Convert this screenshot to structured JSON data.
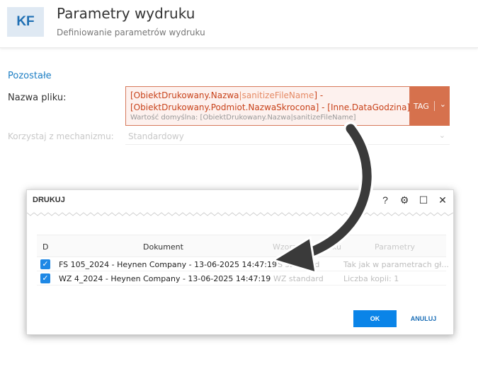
{
  "header": {
    "logo": "KF",
    "title": "Parametry wydruku",
    "subtitle": "Definiowanie parametrów wydruku"
  },
  "section": {
    "title": "Pozostałe"
  },
  "filename_field": {
    "label": "Nazwa pliku:",
    "line1_a": "[ObiektDrukowany.Nazwa",
    "line1_b": "|sanitizeFileName",
    "line1_c": "] -",
    "line2": "[ObiektDrukowany.Podmiot.NazwaSkrocona] - [Inne.DataGodzina]",
    "default_hint": "Wartość domyślna: [ObiektDrukowany.Nazwa|sanitizeFileName]",
    "tag_button": "TAG",
    "tag_chevron": "⌄"
  },
  "mechanism_field": {
    "label": "Korzystaj z mechanizmu:",
    "value": "Standardowy",
    "chevron": "⌄"
  },
  "dialog": {
    "title": "DRUKUJ",
    "icons": [
      "help-icon",
      "gear-icon",
      "maximize-icon",
      "close-icon"
    ],
    "icon_glyphs": [
      "?",
      "⚙",
      "☐",
      "✕"
    ],
    "columns": [
      "D",
      "Dokument",
      "Wzorzec wydruku",
      "Parametry"
    ],
    "rows": [
      {
        "checked": true,
        "document": "FS 105_2024 - Heynen Company - 13-06-2025 14:47:19",
        "template": "FS standard",
        "params": "Tak jak w parametrach gł..."
      },
      {
        "checked": true,
        "document": "WZ 4_2024 - Heynen Company - 13-06-2025 14:47:19",
        "template": "WZ standard",
        "params": "Liczba kopii: 1"
      }
    ],
    "ok_label": "OK",
    "cancel_label": "ANULUJ"
  },
  "colors": {
    "accent_blue": "#0a84e8",
    "tag_orange": "#d6714d",
    "error_text": "#c8421a",
    "arrow": "#3a3a3a"
  }
}
